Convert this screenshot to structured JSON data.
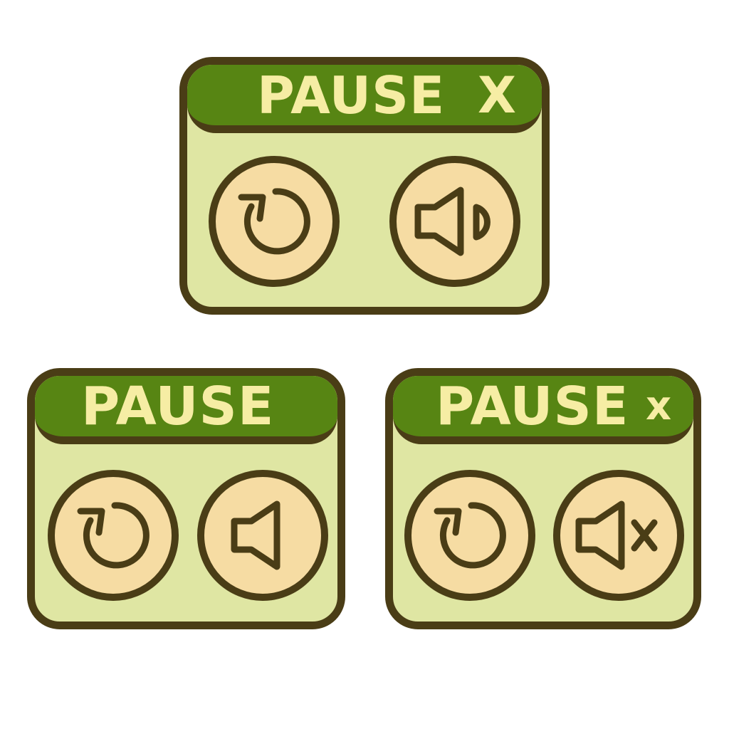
{
  "panels": [
    {
      "title": "PAUSE",
      "close_glyph": "X",
      "buttons": [
        "restart-icon",
        "speaker-on-icon"
      ]
    },
    {
      "title": "PAUSE",
      "close_glyph": "",
      "buttons": [
        "restart-icon",
        "speaker-icon"
      ]
    },
    {
      "title": "PAUSE",
      "close_glyph": "x",
      "buttons": [
        "restart-icon",
        "speaker-muted-icon"
      ]
    }
  ],
  "colors": {
    "panel_fill": "#dfe6a3",
    "title_fill": "#578513",
    "outline": "#4a3d16",
    "button_fill": "#f6dca3",
    "title_text": "#f6eda4"
  }
}
